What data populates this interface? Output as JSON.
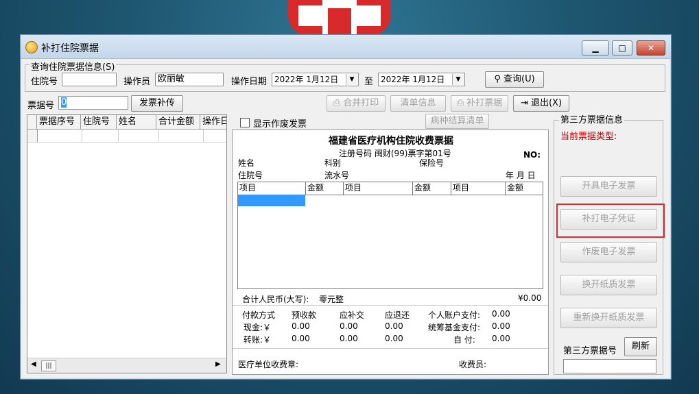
{
  "window": {
    "title": "补打住院票据"
  },
  "query_group": {
    "title": "查询住院票据信息(S)",
    "inpatient_no_label": "住院号",
    "inpatient_no_value": "",
    "operator_label": "操作员",
    "operator_value": "欧丽敏",
    "date_label": "操作日期",
    "date_from": "2022年 1月12日",
    "to_label": "至",
    "date_to": "2022年 1月12日",
    "search_button": "查询(U)"
  },
  "ticket_row": {
    "ticket_no_label": "票据号",
    "ticket_no_value": "0",
    "reupload_button": "发票补传",
    "merge_print_button": "合并打印",
    "detail_button": "清单信息",
    "reprint_button": "补打票据",
    "exit_button": "退出(X)"
  },
  "list_table": {
    "columns": [
      "票据序号",
      "住院号",
      "姓名",
      "合计金额",
      "操作日"
    ]
  },
  "show_void": {
    "label": "显示作废发票",
    "checked": false
  },
  "disease_settlement_button": "病种结算清单",
  "receipt": {
    "title": "福建省医疗机构住院收费票据",
    "reg_no": "注册号码 闽财(99)票字第01号",
    "no_label": "NO:",
    "name_label": "姓名",
    "dept_label": "科别",
    "insurance_label": "保险号",
    "inpatient_label": "住院号",
    "serial_label": "流水号",
    "date_label": "年  月  日",
    "item_columns": [
      "项目",
      "金额",
      "项目",
      "金额",
      "项目",
      "金额"
    ],
    "total_label": "合计人民币(大写):",
    "total_words": "零元整",
    "total_amount": "¥0.00",
    "pay_method_label": "付款方式",
    "prepaid_label": "预收款",
    "pay_more_label": "应补交",
    "refund_label": "应退还",
    "personal_label": "个人账户支付:",
    "personal_value": "0.00",
    "pool_label": "统筹基金支付:",
    "pool_value": "0.00",
    "self_label": "自  付:",
    "self_value": "0.00",
    "cash_label": "现金:￥",
    "cash_prepaid": "0.00",
    "cash_more": "0.00",
    "cash_refund": "0.00",
    "transfer_label": "转账:￥",
    "transfer_prepaid": "0.00",
    "transfer_more": "0.00",
    "transfer_refund": "0.00",
    "stamp_label": "医疗单位收费章:",
    "cashier_label": "收费员:"
  },
  "third_party": {
    "title": "第三方票据信息",
    "current_type_label": "当前票据类型:",
    "issue_button": "开具电子发票",
    "reprint_voucher_button": "补打电子凭证",
    "void_button": "作废电子发票",
    "paper_button": "换开纸质发票",
    "repaper_button": "重新换开纸质发票",
    "number_label": "第三方票据号",
    "refresh_button": "刷新",
    "number_value": ""
  },
  "colors": {
    "accent_red": "#e02a2a",
    "selection": "#3399ff"
  }
}
